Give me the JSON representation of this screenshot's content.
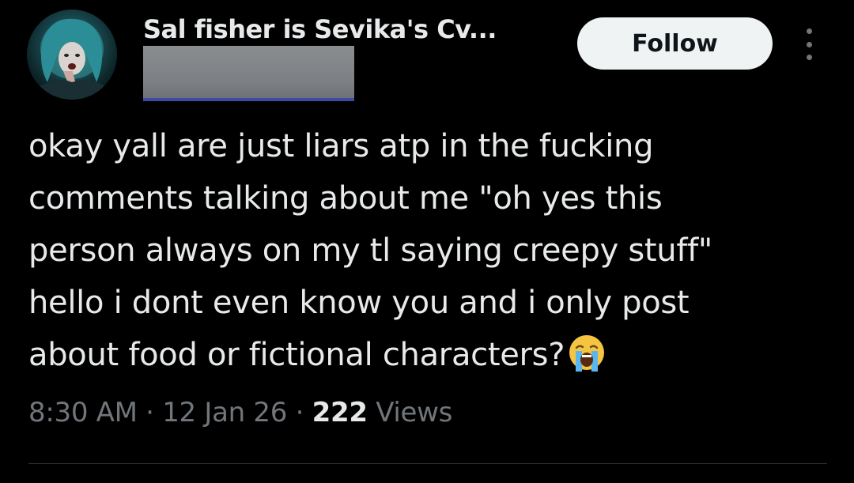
{
  "author": {
    "display_name": "Sal fisher is Sevika's Cv...",
    "handle_redacted": true,
    "avatar_icon": "anime-character-avatar"
  },
  "header": {
    "follow_label": "Follow",
    "more_icon": "more-vertical-icon"
  },
  "tweet": {
    "lines": [
      "okay yall are just liars atp in the fucking",
      "comments talking about me \"oh yes this",
      "person always on my tl saying creepy stuff\"",
      "hello i dont even know you and i only post",
      "about food or fictional characters?"
    ],
    "emoji_icon": "loudly-crying-face-emoji"
  },
  "meta": {
    "time": "8:30 AM",
    "separator": "·",
    "date": "12 Jan 26",
    "views_count": "222",
    "views_label": "Views"
  },
  "colors": {
    "background": "#000000",
    "text_primary": "#e7e9ea",
    "text_secondary": "#71767b",
    "follow_bg": "#eff3f4",
    "divider": "#2f3336"
  }
}
